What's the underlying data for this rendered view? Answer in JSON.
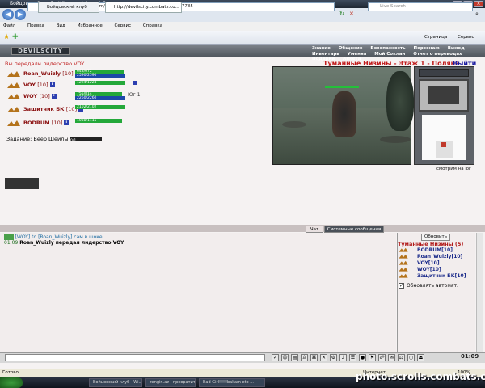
{
  "window": {
    "title": "Бойцовский клуб - Windows Internet Explorer"
  },
  "address": {
    "url": "http://devilscity.combats.com/buttons.pl?battle=0.481636438147785",
    "search_placeholder": "Live Search"
  },
  "menu": [
    "Файл",
    "Правка",
    "Вид",
    "Избранное",
    "Сервис",
    "Справка"
  ],
  "tabs": [
    {
      "label": "Бойцовский клуб"
    },
    {
      "label": "http://devilscity.combats.co..."
    }
  ],
  "toolbar_right": {
    "page": "Страница",
    "tools": "Сервис"
  },
  "game": {
    "logo": "DEVILSCITY",
    "nav_top": [
      "Знание",
      "Общение",
      "Безопасность",
      "Персонаж",
      "Выход"
    ],
    "nav_bottom": [
      "Инвентарь",
      "Умения",
      "Мой Соклан",
      "Отчет о переводах",
      "Подарки",
      "Анкета"
    ],
    "leadership_msg": "Вы передали лидерство VOY",
    "location": "Туманные Низины - Этаж 1 - Поляна",
    "exit": "Выйти",
    "party": [
      {
        "name": "Roan_Wuizly",
        "level": "[10]",
        "hp": "643/672",
        "mana": "2590/2590",
        "hp_frac": 0.96,
        "mana_frac": 1.0,
        "extra": ""
      },
      {
        "name": "VOY",
        "level": "[10]",
        "hp": "1224/1224",
        "mana": "",
        "hp_frac": 1.0,
        "mana_frac": 0,
        "extra": ""
      },
      {
        "name": "WOY",
        "level": "[10]",
        "hp": "755/814",
        "mana": "2260/2260",
        "hp_frac": 0.93,
        "mana_frac": 1.0,
        "extra": "Юг-1,"
      },
      {
        "name": "Защитник БК",
        "level": "[10]",
        "hp": "2102/2102",
        "mana": "",
        "hp_frac": 1.0,
        "mana_frac": 0,
        "extra": ""
      },
      {
        "name": "BODRUM",
        "level": "[10]",
        "hp": "1038/1115",
        "mana": "",
        "hp_frac": 0.93,
        "mana_frac": 0,
        "extra": ""
      }
    ],
    "task_label": "Задание: Веер Шейлы",
    "task_value": "0/1",
    "look_dir": "смотрим на юг"
  },
  "chat": {
    "tabs": [
      "Чат",
      "Системные сообщения"
    ],
    "lines": [
      {
        "time": "",
        "text": "[WOY] to [Roan_Wuizly] сам в шоке"
      },
      {
        "time": "01:09",
        "text": "Roan_Wuizly передал лидерство VOY"
      }
    ],
    "clock": "01:09"
  },
  "sidepanel": {
    "refresh": "Обновить",
    "zone": "Туманные Низины (5)",
    "players": [
      {
        "name": "BODRUM[10]"
      },
      {
        "name": "Roan_Wuizly[10]"
      },
      {
        "name": "VOY[10]"
      },
      {
        "name": "WOY[10]"
      },
      {
        "name": "Защитник БК[10]"
      }
    ],
    "auto": "Обновлять автомат."
  },
  "status": {
    "ready": "Готово",
    "zone": "Интернет",
    "zoom": "100%"
  },
  "taskbar": [
    {
      "label": "Бойцовский клуб - Wi..."
    },
    {
      "label": "zengin.az - превратит..."
    },
    {
      "label": "Bad Girl!!!!!bakam eto ..."
    }
  ],
  "watermark": "photo.scrolls.combats.com"
}
